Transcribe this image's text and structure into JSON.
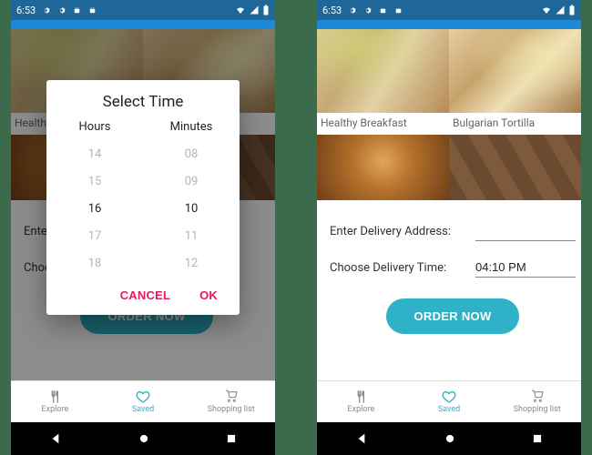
{
  "status": {
    "clock": "6:53",
    "icons": [
      "gear-icon",
      "gear-icon",
      "android-icon",
      "android-icon"
    ],
    "right_icons": [
      "wifi-icon",
      "signal-icon",
      "battery-icon"
    ]
  },
  "foods": {
    "row1": [
      {
        "name": "Healthy Breakfast"
      },
      {
        "name": "Bulgarian Tortilla"
      }
    ]
  },
  "form": {
    "address_label": "Enter Delivery Address:",
    "address_value": "",
    "time_label": "Choose Delivery Time:",
    "time_value": "04:10 PM"
  },
  "order_button": "ORDER NOW",
  "tabs": {
    "explore": "Explore",
    "saved": "Saved",
    "shopping": "Shopping list",
    "active": "saved"
  },
  "dialog": {
    "title": "Select Time",
    "hours_header": "Hours",
    "minutes_header": "Minutes",
    "hours": [
      "14",
      "15",
      "16",
      "17",
      "18"
    ],
    "minutes": [
      "08",
      "09",
      "10",
      "11",
      "12"
    ],
    "selected_hour": "16",
    "selected_minute": "10",
    "cancel": "CANCEL",
    "ok": "OK"
  },
  "left": {
    "address_label_short": "Enter D",
    "time_label_short": "Choose"
  }
}
